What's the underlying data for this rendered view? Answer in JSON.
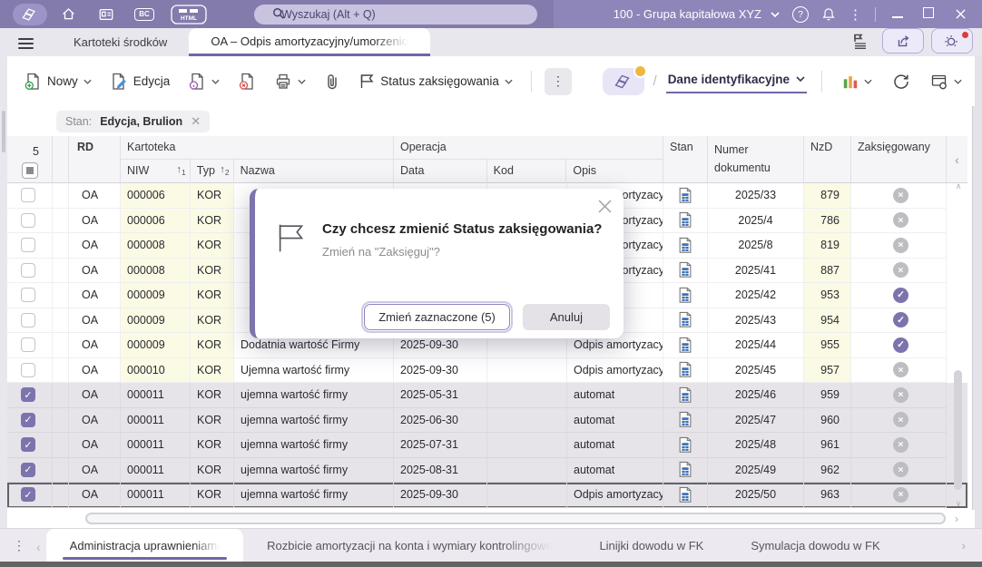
{
  "colors": {
    "accent": "#6f67a8",
    "titlebar": "#837bac",
    "selection": "#7c74ad",
    "row_highlight": "#fbfae5",
    "selected_row": "#e6e4e9",
    "posted_yes": "#7c74ad",
    "posted_no": "#bdbdc2",
    "alert_dot": "#e03b3b",
    "badge_dot": "#efb73e"
  },
  "titlebar": {
    "search_placeholder": "Wyszukaj (Alt + Q)",
    "company_selector": "100 - Grupa kapitałowa XYZ"
  },
  "nav_tabs": {
    "items": [
      {
        "label": "Kartoteki środków",
        "active": false
      },
      {
        "label": "OA – Odpis amortyzacyjny/umorzenio",
        "active": true
      }
    ]
  },
  "toolbar": {
    "new_label": "Nowy",
    "edit_label": "Edycja",
    "status_label": "Status zaksięgowania",
    "view_selector_label": "Dane identyfikacyjne",
    "view_separator": "/"
  },
  "filter": {
    "chip_prefix": "Stan:",
    "chip_value": "Edycja, Brulion"
  },
  "table": {
    "selection_count": "5",
    "group_kartoteka": "Kartoteka",
    "group_operacja": "Operacja",
    "col_rd": "RD",
    "col_niw": "NIW",
    "col_typ": "Typ",
    "col_nazwa": "Nazwa",
    "col_data": "Data",
    "col_kod": "Kod",
    "col_opis": "Opis",
    "col_stan": "Stan",
    "col_numer": "Numer dokumentu",
    "col_nzd": "NzD",
    "col_zaksiegowany": "Zaksięgowany",
    "sort_primary": "1",
    "sort_secondary": "2",
    "rows": [
      {
        "checked": false,
        "rd": "OA",
        "niw": "000006",
        "typ": "KOR",
        "nazwa": "",
        "data": "",
        "kod": "",
        "opis": "Odpis amortyzacyjny",
        "numer": "2025/33",
        "nzd": "879",
        "posted": false,
        "focused": false
      },
      {
        "checked": false,
        "rd": "OA",
        "niw": "000006",
        "typ": "KOR",
        "nazwa": "",
        "data": "",
        "kod": "",
        "opis": "Odpis amortyzacyjny",
        "numer": "2025/4",
        "nzd": "786",
        "posted": false,
        "focused": false
      },
      {
        "checked": false,
        "rd": "OA",
        "niw": "000008",
        "typ": "KOR",
        "nazwa": "",
        "data": "",
        "kod": "",
        "opis": "Odpis amortyzacyjny",
        "numer": "2025/8",
        "nzd": "819",
        "posted": false,
        "focused": false
      },
      {
        "checked": false,
        "rd": "OA",
        "niw": "000008",
        "typ": "KOR",
        "nazwa": "",
        "data": "",
        "kod": "",
        "opis": "Odpis amortyzacyjny",
        "numer": "2025/41",
        "nzd": "887",
        "posted": false,
        "focused": false
      },
      {
        "checked": false,
        "rd": "OA",
        "niw": "000009",
        "typ": "KOR",
        "nazwa": "",
        "data": "",
        "kod": "",
        "opis": "",
        "numer": "2025/42",
        "nzd": "953",
        "posted": true,
        "focused": false
      },
      {
        "checked": false,
        "rd": "OA",
        "niw": "000009",
        "typ": "KOR",
        "nazwa": "",
        "data": "",
        "kod": "",
        "opis": "",
        "numer": "2025/43",
        "nzd": "954",
        "posted": true,
        "focused": false
      },
      {
        "checked": false,
        "rd": "OA",
        "niw": "000009",
        "typ": "KOR",
        "nazwa": "Dodatnia wartość Firmy",
        "data": "2025-09-30",
        "kod": "",
        "opis": "Odpis amortyzacyjny",
        "numer": "2025/44",
        "nzd": "955",
        "posted": true,
        "focused": false
      },
      {
        "checked": false,
        "rd": "OA",
        "niw": "000010",
        "typ": "KOR",
        "nazwa": "Ujemna wartość firmy",
        "data": "2025-09-30",
        "kod": "",
        "opis": "Odpis amortyzacyjny",
        "numer": "2025/45",
        "nzd": "957",
        "posted": false,
        "focused": false
      },
      {
        "checked": true,
        "rd": "OA",
        "niw": "000011",
        "typ": "KOR",
        "nazwa": "ujemna wartość firmy",
        "data": "2025-05-31",
        "kod": "",
        "opis": "automat",
        "numer": "2025/46",
        "nzd": "959",
        "posted": false,
        "focused": false
      },
      {
        "checked": true,
        "rd": "OA",
        "niw": "000011",
        "typ": "KOR",
        "nazwa": "ujemna wartość firmy",
        "data": "2025-06-30",
        "kod": "",
        "opis": "automat",
        "numer": "2025/47",
        "nzd": "960",
        "posted": false,
        "focused": false
      },
      {
        "checked": true,
        "rd": "OA",
        "niw": "000011",
        "typ": "KOR",
        "nazwa": "ujemna wartość firmy",
        "data": "2025-07-31",
        "kod": "",
        "opis": "automat",
        "numer": "2025/48",
        "nzd": "961",
        "posted": false,
        "focused": false
      },
      {
        "checked": true,
        "rd": "OA",
        "niw": "000011",
        "typ": "KOR",
        "nazwa": "ujemna wartość firmy",
        "data": "2025-08-31",
        "kod": "",
        "opis": "automat",
        "numer": "2025/49",
        "nzd": "962",
        "posted": false,
        "focused": false
      },
      {
        "checked": true,
        "rd": "OA",
        "niw": "000011",
        "typ": "KOR",
        "nazwa": "ujemna wartość firmy",
        "data": "2025-09-30",
        "kod": "",
        "opis": "Odpis amortyzacyjny",
        "numer": "2025/50",
        "nzd": "963",
        "posted": false,
        "focused": true
      }
    ]
  },
  "dialog": {
    "title": "Czy chcesz zmienić Status zaksięgowania?",
    "subtitle": "Zmień na \"Zaksięguj\"?",
    "confirm_label": "Zmień zaznaczone (5)",
    "cancel_label": "Anuluj"
  },
  "bottom_tabs": {
    "items": [
      {
        "label": "Administracja uprawnieniami",
        "active": true
      },
      {
        "label": "Rozbicie amortyzacji na konta i wymiary kontrolingowe",
        "active": false
      },
      {
        "label": "Linijki dowodu w FK",
        "active": false
      },
      {
        "label": "Symulacja dowodu w FK",
        "active": false
      }
    ]
  }
}
